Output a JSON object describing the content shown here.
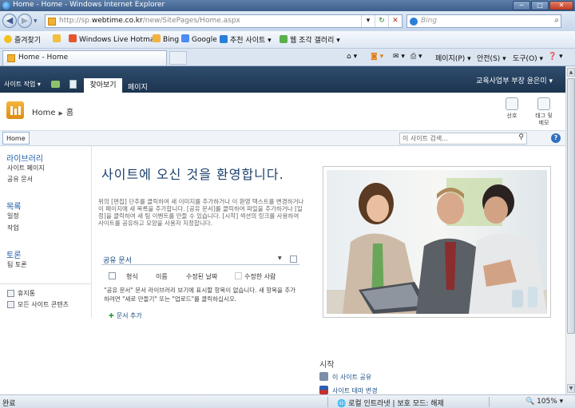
{
  "window": {
    "title": "Home - Home - Windows Internet Explorer",
    "minimize": "─",
    "maximize": "□",
    "close": "✕"
  },
  "address_bar": {
    "url_prefix": "http://sp.",
    "url_domain": "webtime.co.kr",
    "url_suffix": "/new/SitePages/Home.aspx",
    "search_placeholder": "Bing",
    "refresh": "↻",
    "stop": "✕"
  },
  "favorites_bar": {
    "favorites_label": "즐겨찾기",
    "items": [
      "Windows Live Hotmail",
      "Bing",
      "Google",
      "추천 사이트 ▾",
      "웹 조각 갤러리 ▾"
    ]
  },
  "tab": {
    "title": "Home - Home"
  },
  "command_bar": {
    "page_menu": "페이지(P) ▾",
    "safety_menu": "안전(S) ▾",
    "tools_menu": "도구(O) ▾",
    "help_menu": "❓ ▾"
  },
  "ribbon": {
    "site_actions": "사이트 작업 ▾",
    "tab_browse": "찾아보기",
    "tab_page": "페이지",
    "user_name": "교육사업부 부장 윤은미 ▾"
  },
  "title_area": {
    "breadcrumb": [
      "Home",
      "홈"
    ],
    "like_it": "선호",
    "tags_notes": [
      "태그 및",
      "메모"
    ]
  },
  "top_nav": {
    "home": "Home",
    "search_placeholder": "이 사이트 검색...",
    "help": "?"
  },
  "quick_launch": {
    "sections": [
      {
        "heading": "라이브러리",
        "items": [
          "사이트 페이지",
          "공유 문서"
        ]
      },
      {
        "heading": "목록",
        "items": [
          "일정",
          "작업"
        ]
      },
      {
        "heading": "토론",
        "items": [
          "팀 토론"
        ]
      }
    ],
    "bottom_items": [
      "휴지통",
      "모든 사이트 콘텐츠"
    ]
  },
  "main": {
    "welcome_title": "사이트에 오신 것을 환영합니다.",
    "description": "위의 [편집] 단추를 클릭하여 새 이미지를 추가하거나 이 환영 텍스트를 변경하거나 이 페이지에 새 목록을 추가합니다. [공유 문서]를 클릭하여 파일을 추가하거나 [일정]을 클릭하여 새 팀 이벤트를 만들 수 있습니다. [시작] 섹션의 링크를 사용하여 사이트를 공유하고 모양을 사용자 지정합니다.",
    "doclib": {
      "title": "공유 문서",
      "columns": [
        "형식",
        "이름",
        "수정된 날짜",
        "수정한 사람"
      ],
      "empty_message": "\"공유 문서\" 문서 라이브러리 보기에 표시할 항목이 없습니다. 새 항목을 추가하려면 \"새로 만들기\" 또는 \"업로드\"를 클릭하십시오.",
      "add_document": "문서 추가"
    },
    "getting_started": {
      "heading": "시작",
      "links": [
        "이 사이트 공유",
        "사이트 테마 변경"
      ]
    }
  },
  "status_bar": {
    "done": "완료",
    "zone": "로컬 인트라넷 | 보호 모드: 해제",
    "zoom": "105%"
  }
}
